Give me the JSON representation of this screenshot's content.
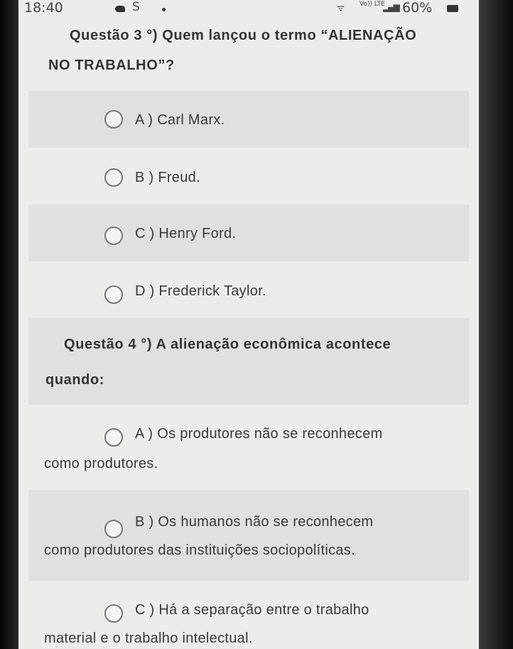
{
  "status_bar": {
    "time": "18:40",
    "carrier_glyph": "S",
    "network": "Vo)) LTE",
    "battery": "60%"
  },
  "question3": {
    "title_line1": "Questão 3 °) Quem lançou o termo “ALIENAÇÃO",
    "title_line2": "NO TRABALHO”?",
    "options": [
      {
        "label": "A ) Carl Marx."
      },
      {
        "label": "B ) Freud."
      },
      {
        "label": "C ) Henry Ford."
      },
      {
        "label": "D ) Frederick Taylor."
      }
    ]
  },
  "question4": {
    "title_line1": "Questão 4 °) A alienação econômica acontece",
    "title_line2": "quando:",
    "options": [
      {
        "line1": "A ) Os produtores não se reconhecem",
        "line2": "como produtores."
      },
      {
        "line1": "B ) Os humanos não se reconhecem",
        "line2": "como produtores das instituições sociopolíticas."
      },
      {
        "line1": "C ) Há a separação entre o trabalho",
        "line2": "material e o trabalho intelectual."
      }
    ]
  }
}
